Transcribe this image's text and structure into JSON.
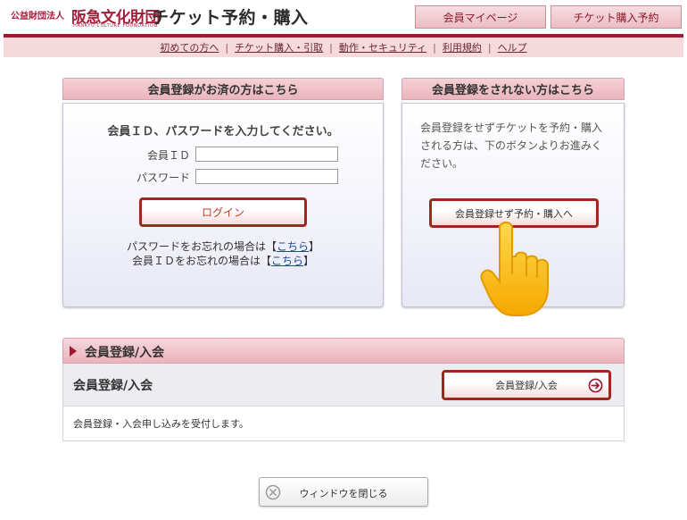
{
  "header": {
    "org_prefix": "公益財団法人",
    "org_name": "阪急文化財団",
    "org_name_en": "HANKYU CULTURE FOUNDATION",
    "title": "チケット予約・購入",
    "mypage_label": "会員マイページ",
    "reserve_label": "チケット購入予約",
    "accent_color": "#9e1b34"
  },
  "nav": {
    "items": [
      {
        "label": "初めての方へ"
      },
      {
        "label": "チケット購入・引取"
      },
      {
        "label": "動作・セキュリティ"
      },
      {
        "label": "利用規約"
      },
      {
        "label": "ヘルプ"
      }
    ],
    "separator": "|"
  },
  "login_panel": {
    "heading": "会員登録がお済の方はこちら",
    "instruction": "会員ＩＤ、パスワードを入力してください。",
    "id_label": "会員ＩＤ",
    "password_label": "パスワード",
    "id_value": "",
    "password_value": "",
    "login_button": "ログイン",
    "forgot_password_prefix": "パスワードをお忘れの場合は【",
    "forgot_id_prefix": "会員ＩＤをお忘れの場合は【",
    "link_text": "こちら",
    "bracket_close": "】"
  },
  "guest_panel": {
    "heading": "会員登録をされない方はこちら",
    "description": "会員登録をせずチケットを予約・購入される方は、下のボタンよりお進みください。",
    "button": "会員登録せず予約・購入へ",
    "pointer_icon": "pointing-hand-icon"
  },
  "registration": {
    "section_title": "会員登録/入会",
    "row_title": "会員登録/入会",
    "button": "会員登録/入会",
    "button_icon": "arrow-right-circle-icon",
    "description": "会員登録・入会申し込みを受付します。"
  },
  "close_window": {
    "label": "ウィンドウを閉じる",
    "icon": "close-circle-icon"
  }
}
